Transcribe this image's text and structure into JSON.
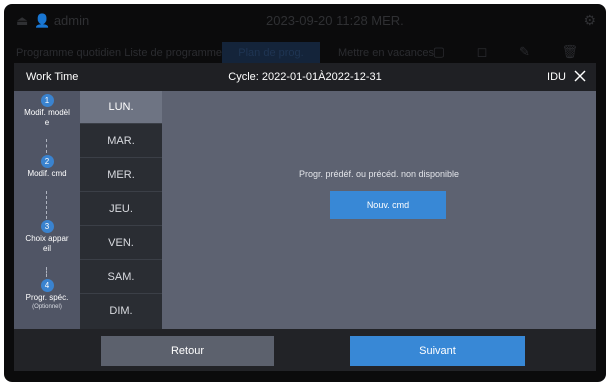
{
  "background": {
    "back_icon": "exit-icon",
    "user_icon": "person-icon",
    "username": "admin",
    "datetime": "2023-09-20 11:28 MER.",
    "sub_left": "Programme quotidien   Liste de programmes",
    "sub_tab": "Plan de prog.",
    "sub_right": "Mettre en vacances",
    "toolbar_icons": "▢ ◻ ✎ 🗑"
  },
  "modal": {
    "title": "Work Time",
    "cycle": "Cycle: 2022-01-01À2022-12-31",
    "device": "IDU",
    "close_icon": "close-icon",
    "steps": [
      {
        "num": "1",
        "label": "Modif. modèl\ne",
        "sub": ""
      },
      {
        "num": "2",
        "label": "Modif. cmd",
        "sub": ""
      },
      {
        "num": "3",
        "label": "Choix appar\neil",
        "sub": ""
      },
      {
        "num": "4",
        "label": "Progr. spéc.",
        "sub": "(Optionnel)"
      }
    ],
    "days": [
      "LUN.",
      "MAR.",
      "MER.",
      "JEU.",
      "VEN.",
      "SAM.",
      "DIM."
    ],
    "selected_day": "LUN.",
    "empty_message": "Progr. prédéf. ou précéd. non disponible",
    "new_cmd_label": "Nouv. cmd",
    "back_label": "Retour",
    "next_label": "Suivant"
  },
  "colors": {
    "accent": "#3888d6",
    "panel": "#5d6271",
    "header": "#1f2024",
    "day_list": "#2a2d33"
  }
}
